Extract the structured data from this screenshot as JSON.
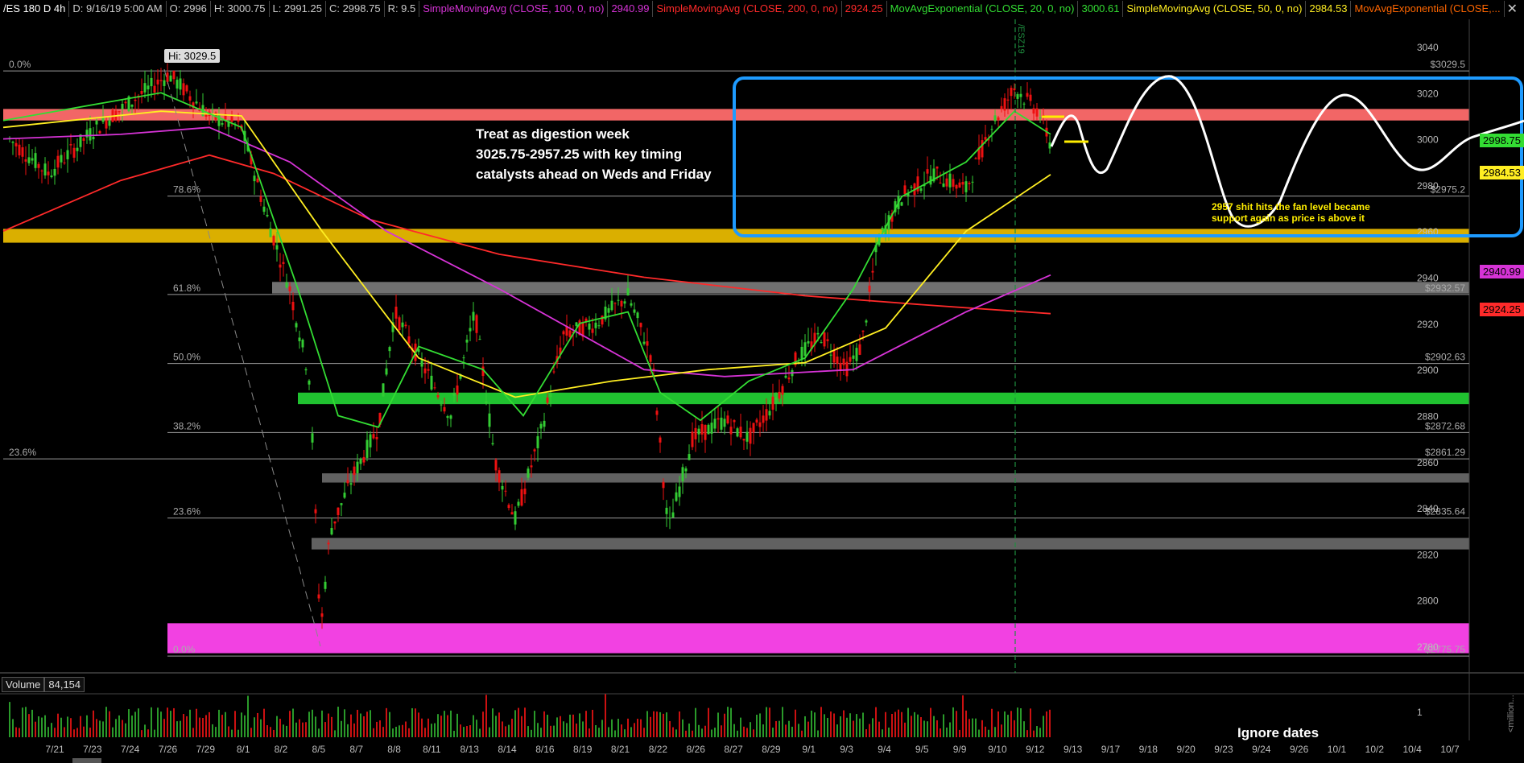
{
  "header": {
    "symbol": "/ES 180 D 4h",
    "datetime": "D: 9/16/19 5:00 AM",
    "open": "O: 2996",
    "high": "H: 3000.75",
    "low": "L: 2991.25",
    "close": "C: 2998.75",
    "range": "R: 9.5",
    "studies": [
      {
        "name": "SimpleMovingAvg (CLOSE, 100, 0, no)",
        "value": "2940.99",
        "color": "#d633d6"
      },
      {
        "name": "SimpleMovingAvg (CLOSE, 200, 0, no)",
        "value": "2924.25",
        "color": "#ff2a2a"
      },
      {
        "name": "MovAvgExponential (CLOSE, 20, 0, no)",
        "value": "3000.61",
        "color": "#33dd33"
      },
      {
        "name": "SimpleMovingAvg (CLOSE, 50, 0, no)",
        "value": "2984.53",
        "color": "#ffee22"
      },
      {
        "name": "MovAvgExponential (CLOSE,...",
        "value": "",
        "color": "#ff6600"
      }
    ]
  },
  "annotations": {
    "hi_tag": "Hi: 3029.5",
    "note_main": "Treat as digestion week\n3025.75-2957.25 with key timing\ncatalysts ahead on Weds and Friday",
    "note_side": "2957 shit hits the fan level became\nsupport again as price is above it",
    "ignore_dates": "Ignore dates",
    "vertical_marker": "/ESZ19"
  },
  "volume_panel": {
    "label": "Volume",
    "value": "84,154",
    "axis_ticks": [
      "1"
    ],
    "unit_label": "<million..."
  },
  "price_badges": [
    {
      "value": "2998.75",
      "color": "#33dd33"
    },
    {
      "value": "2984.53",
      "color": "#ffee22"
    },
    {
      "value": "2940.99",
      "color": "#d633d6"
    },
    {
      "value": "2924.25",
      "color": "#ff2a2a"
    }
  ],
  "chart_data": {
    "type": "candlestick",
    "ylim": [
      2770,
      3045
    ],
    "y_ticks": [
      2780,
      2800,
      2820,
      2840,
      2860,
      2880,
      2900,
      2920,
      2940,
      2960,
      2980,
      3000,
      3020,
      3040
    ],
    "x_ticks": [
      "7/21",
      "7/23",
      "7/24",
      "7/26",
      "7/29",
      "8/1",
      "8/2",
      "8/5",
      "8/7",
      "8/8",
      "8/11",
      "8/13",
      "8/14",
      "8/16",
      "8/19",
      "8/21",
      "8/22",
      "8/26",
      "8/27",
      "8/29",
      "9/1",
      "9/3",
      "9/4",
      "9/5",
      "9/9",
      "9/10",
      "9/12",
      "9/13",
      "9/17",
      "9/18",
      "9/20",
      "9/23",
      "9/24",
      "9/26",
      "10/1",
      "10/2",
      "10/4",
      "10/7"
    ],
    "fib_levels": [
      {
        "pct": "0.0%",
        "price": 3029.5,
        "label": "$3029.5"
      },
      {
        "pct": "78.6%",
        "price": 2975.2,
        "label": "$2975.2"
      },
      {
        "pct": "61.8%",
        "price": 2932.57,
        "label": "$2932.57"
      },
      {
        "pct": "50.0%",
        "price": 2902.63,
        "label": "$2902.63"
      },
      {
        "pct": "38.2%",
        "price": 2872.68,
        "label": "$2872.68"
      },
      {
        "pct": "23.6%",
        "price": 2861.29,
        "label": "$2861.29"
      },
      {
        "pct": "23.6%",
        "price": 2835.64,
        "label": "$2835.64"
      },
      {
        "pct": "0.0%",
        "price": 2775.75,
        "label": "$2775.75"
      }
    ],
    "zones": [
      {
        "color": "#ff6b6b",
        "from": 3008,
        "to": 3013
      },
      {
        "color": "#e6b800",
        "from": 2955,
        "to": 2961
      },
      {
        "color": "#777777",
        "from": 2933,
        "to": 2938
      },
      {
        "color": "#22cc33",
        "from": 2885,
        "to": 2890
      },
      {
        "color": "#666666",
        "from": 2851,
        "to": 2855
      },
      {
        "color": "#666666",
        "from": 2822,
        "to": 2827
      },
      {
        "color": "#ff44ee",
        "from": 2777,
        "to": 2790
      }
    ],
    "series": [
      {
        "color": "#d633d6",
        "last": 2940.99
      },
      {
        "color": "#ff2a2a",
        "last": 2924.25
      },
      {
        "color": "#33dd33",
        "last": 3000.61
      },
      {
        "color": "#ffee22",
        "last": 2984.53
      }
    ]
  }
}
